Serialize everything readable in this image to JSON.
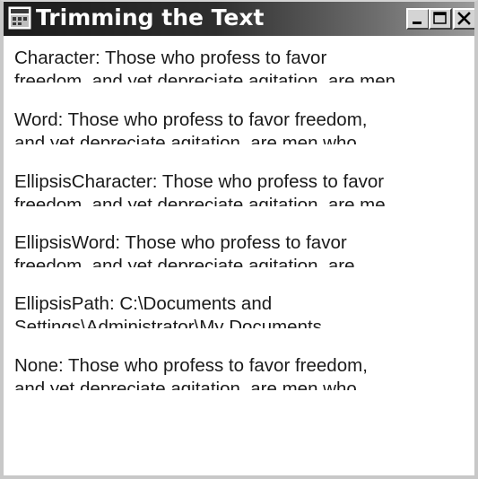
{
  "window": {
    "title": "Trimming the Text"
  },
  "labels": [
    {
      "line1": "Character: Those who profess to favor",
      "line2": "freedom, and yet depreciate agitation, are men"
    },
    {
      "line1": "Word: Those who profess to favor freedom,",
      "line2": "and yet depreciate agitation, are men who"
    },
    {
      "line1": "EllipsisCharacter: Those who profess to favor",
      "line2": "freedom, and yet depreciate agitation, are me..."
    },
    {
      "line1": "EllipsisWord: Those who profess to favor",
      "line2": "freedom, and yet depreciate agitation, are..."
    },
    {
      "line1": "EllipsisPath: C:\\Documents and",
      "line2": "Settings\\Administrator\\My Documents"
    },
    {
      "line1": "None: Those who profess to favor freedom,",
      "line2": "and yet depreciate agitation, are men who"
    }
  ],
  "icons": {
    "app": "app-window-icon",
    "minimize": "minimize-icon",
    "maximize": "maximize-icon",
    "close": "close-icon"
  }
}
